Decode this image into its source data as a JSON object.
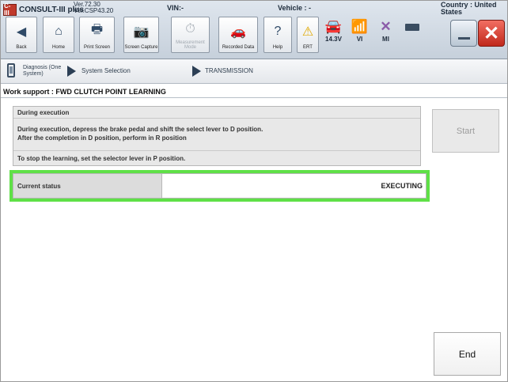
{
  "app": {
    "logo_text": "C-III",
    "name": "CONSULT-III plus",
    "version_line1": "Ver.72.30",
    "version_line2": "Ver.CSP43.20",
    "vin_label": "VIN:-",
    "vehicle_label": "Vehicle : -",
    "country_label": "Country : United States"
  },
  "toolbar": {
    "buttons": [
      {
        "label": "Back",
        "icon": "back-arrow-icon",
        "glyph": "◀",
        "enabled": true
      },
      {
        "label": "Home",
        "icon": "home-icon",
        "glyph": "⌂",
        "enabled": true
      },
      {
        "label": "Print Screen",
        "icon": "print-icon",
        "glyph": "🖶",
        "enabled": true
      },
      {
        "label": "Screen Capture",
        "icon": "camera-icon",
        "glyph": "📷",
        "enabled": true
      },
      {
        "label": "Measurement Mode",
        "icon": "meter-icon",
        "glyph": "⏱",
        "enabled": false
      },
      {
        "label": "Recorded Data",
        "icon": "recorded-data-icon",
        "glyph": "🚗",
        "enabled": true
      },
      {
        "label": "Help",
        "icon": "help-icon",
        "glyph": "?",
        "enabled": true
      },
      {
        "label": "ERT",
        "icon": "warning-icon",
        "glyph": "⚠",
        "enabled": true
      }
    ]
  },
  "status": {
    "battery_voltage": "14.3V",
    "vi_label": "VI",
    "mi_label": "MI"
  },
  "breadcrumb": {
    "diagnosis": "Diagnosis (One System)",
    "system_selection": "System Selection",
    "transmission": "TRANSMISSION"
  },
  "work_support_title": "Work support : FWD CLUTCH POINT LEARNING",
  "info": {
    "title": "During execution",
    "line1": "During execution, depress the brake pedal and shift the select lever to D position.",
    "line2": "After the completion in D position, perform in R position",
    "line3": "To stop the learning, set the selector lever in P position."
  },
  "buttons": {
    "start": "Start",
    "end": "End"
  },
  "current_status": {
    "label": "Current status",
    "value": "EXECUTING"
  },
  "colors": {
    "highlight": "#5fe047",
    "close_button": "#d9362a"
  }
}
